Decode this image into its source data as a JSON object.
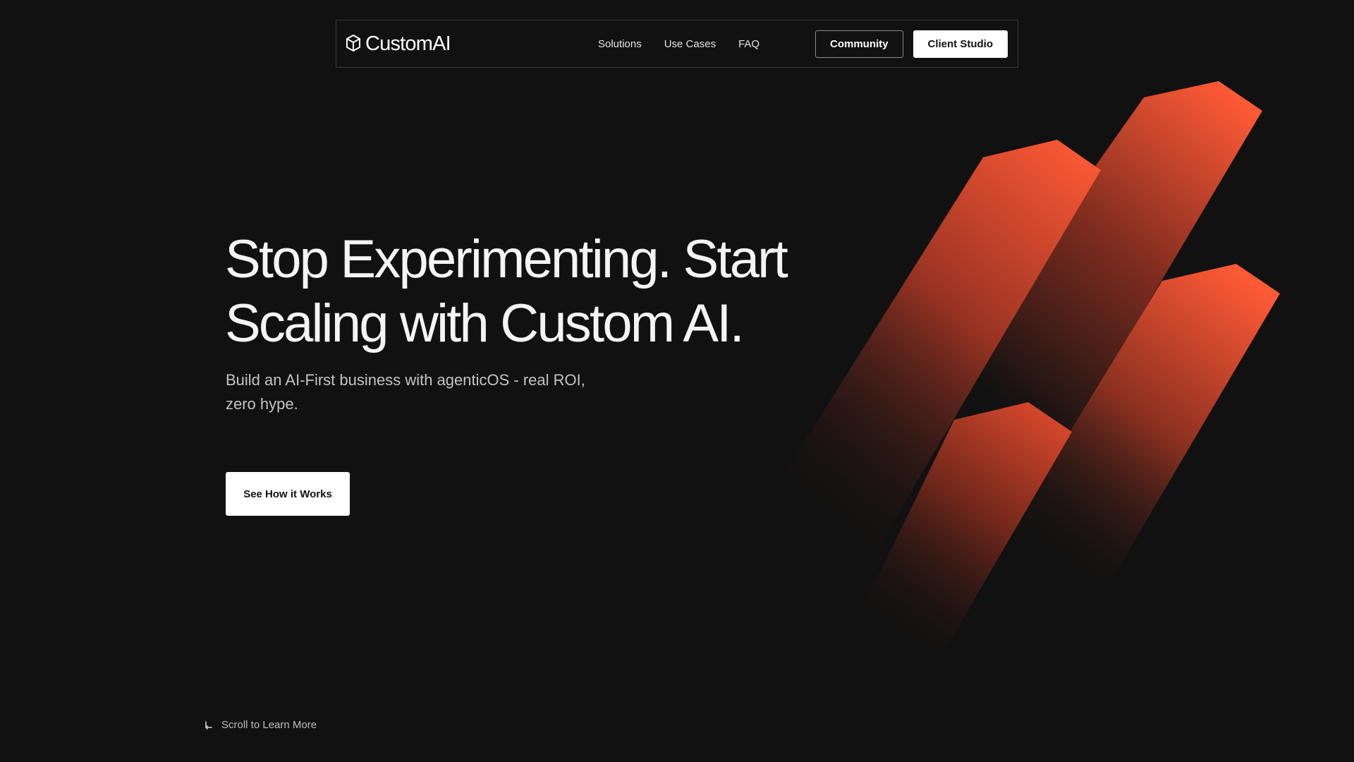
{
  "nav": {
    "logo_text": "CustomAI",
    "logo_icon": "cube-icon",
    "links": [
      {
        "label": "Solutions"
      },
      {
        "label": "Use Cases"
      },
      {
        "label": "FAQ"
      }
    ],
    "community_label": "Community",
    "client_studio_label": "Client Studio"
  },
  "hero": {
    "title_line1": "Stop Experimenting. Start",
    "title_line2": "Scaling with Custom AI.",
    "subtitle_line1": "Build an AI-First business with agenticOS - real ROI,",
    "subtitle_line2": "zero hype.",
    "cta_label": "See How it Works"
  },
  "scroll_hint": {
    "label": "Scroll to Learn More",
    "icon": "arrow-down-left-icon"
  },
  "colors": {
    "background": "#111111",
    "accent": "#ff5a36",
    "text": "#f4f4f4"
  }
}
